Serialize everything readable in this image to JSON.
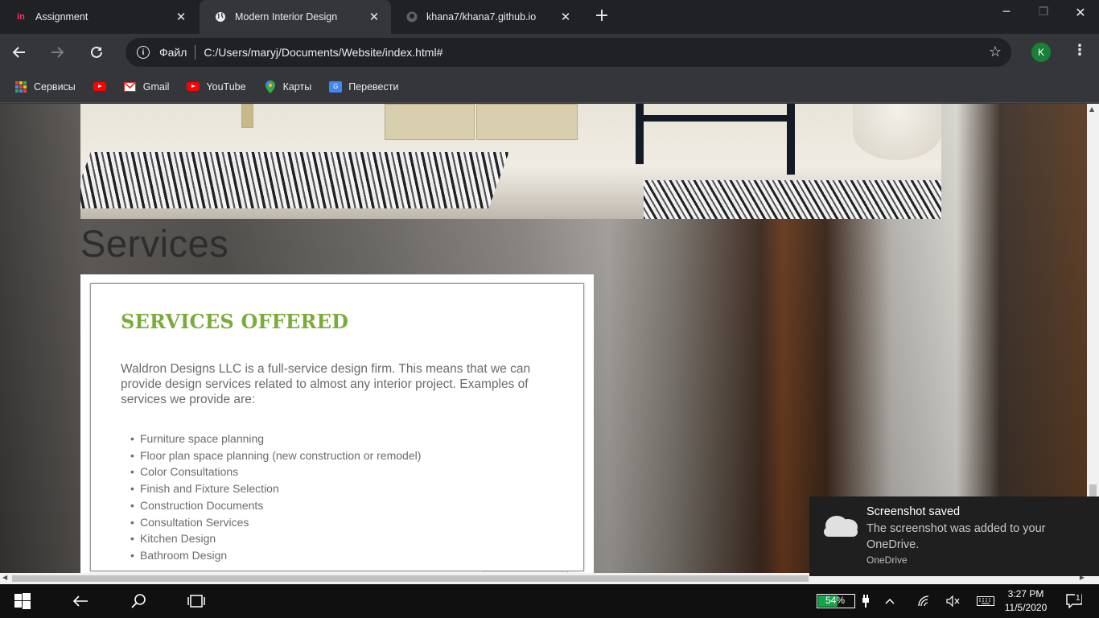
{
  "browser": {
    "tabs": [
      {
        "title": "Assignment",
        "icon": "invision-logo-icon",
        "active": false
      },
      {
        "title": "Modern Interior Design",
        "icon": "globe-icon",
        "active": true
      },
      {
        "title": "khana7/khana7.github.io",
        "icon": "github-icon",
        "active": false
      }
    ],
    "address": {
      "scheme_label": "Файл",
      "url": "C:/Users/maryj/Documents/Website/index.html#"
    },
    "profile_initial": "K",
    "bookmarks": [
      {
        "label": "Сервисы",
        "icon": "apps-grid-icon"
      },
      {
        "label": "",
        "icon": "youtube-icon"
      },
      {
        "label": "Gmail",
        "icon": "gmail-icon"
      },
      {
        "label": "YouTube",
        "icon": "youtube-icon"
      },
      {
        "label": "Карты",
        "icon": "maps-pin-icon"
      },
      {
        "label": "Перевести",
        "icon": "translate-icon"
      }
    ]
  },
  "page": {
    "section_title": "Services",
    "card": {
      "heading": "SERVICES OFFERED",
      "intro": "Waldron Designs LLC is a full-service design firm. This means that we can provide design services related to almost any interior project. Examples of services we provide are:",
      "services": [
        "Furniture space planning",
        "Floor plan space planning (new construction or remodel)",
        "Color Consultations",
        "Finish and Fixture Selection",
        "Construction Documents",
        "Consultation Services",
        "Kitchen Design",
        "Bathroom Design"
      ]
    },
    "heading_color": "#7aac3b"
  },
  "toast": {
    "title": "Screenshot saved",
    "body": "The screenshot was added to your OneDrive.",
    "app": "OneDrive"
  },
  "taskbar": {
    "battery_percent": "54%",
    "battery_level": 0.54,
    "time": "3:27 PM",
    "date": "11/5/2020",
    "notification_count": "1"
  }
}
